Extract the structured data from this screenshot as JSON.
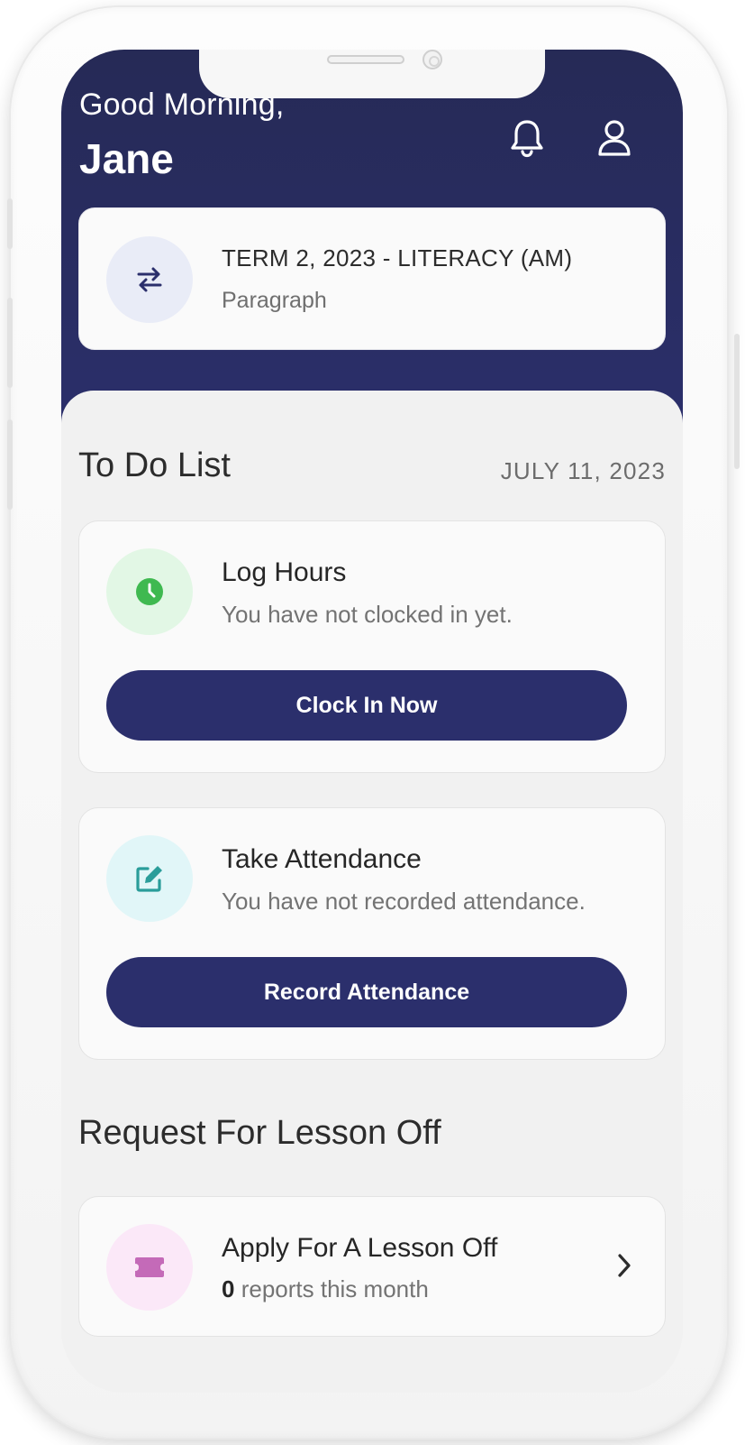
{
  "header": {
    "greeting": "Good Morning,",
    "user_name": "Jane",
    "icons": {
      "notifications": "bell-icon",
      "profile": "user-icon"
    }
  },
  "term_card": {
    "icon": "swap-icon",
    "title": "TERM 2, 2023 - LITERACY (AM)",
    "subtitle": "Paragraph"
  },
  "todo": {
    "title": "To Do List",
    "date": "JULY 11, 2023",
    "items": [
      {
        "icon": "clock-icon",
        "title": "Log Hours",
        "subtitle": "You have not clocked in yet.",
        "button_label": "Clock In Now"
      },
      {
        "icon": "edit-icon",
        "title": "Take Attendance",
        "subtitle": "You have not recorded attendance.",
        "button_label": "Record Attendance"
      }
    ]
  },
  "lesson_off": {
    "section_title": "Request For Lesson Off",
    "icon": "ticket-icon",
    "title": "Apply For A Lesson Off",
    "count": "0",
    "count_suffix": "reports this month"
  },
  "colors": {
    "primary": "#2b2f6c",
    "background": "#f1f1f1",
    "clock_green": "#3fb950",
    "edit_teal": "#2a9d9a",
    "ticket_pink": "#c46ab8"
  }
}
